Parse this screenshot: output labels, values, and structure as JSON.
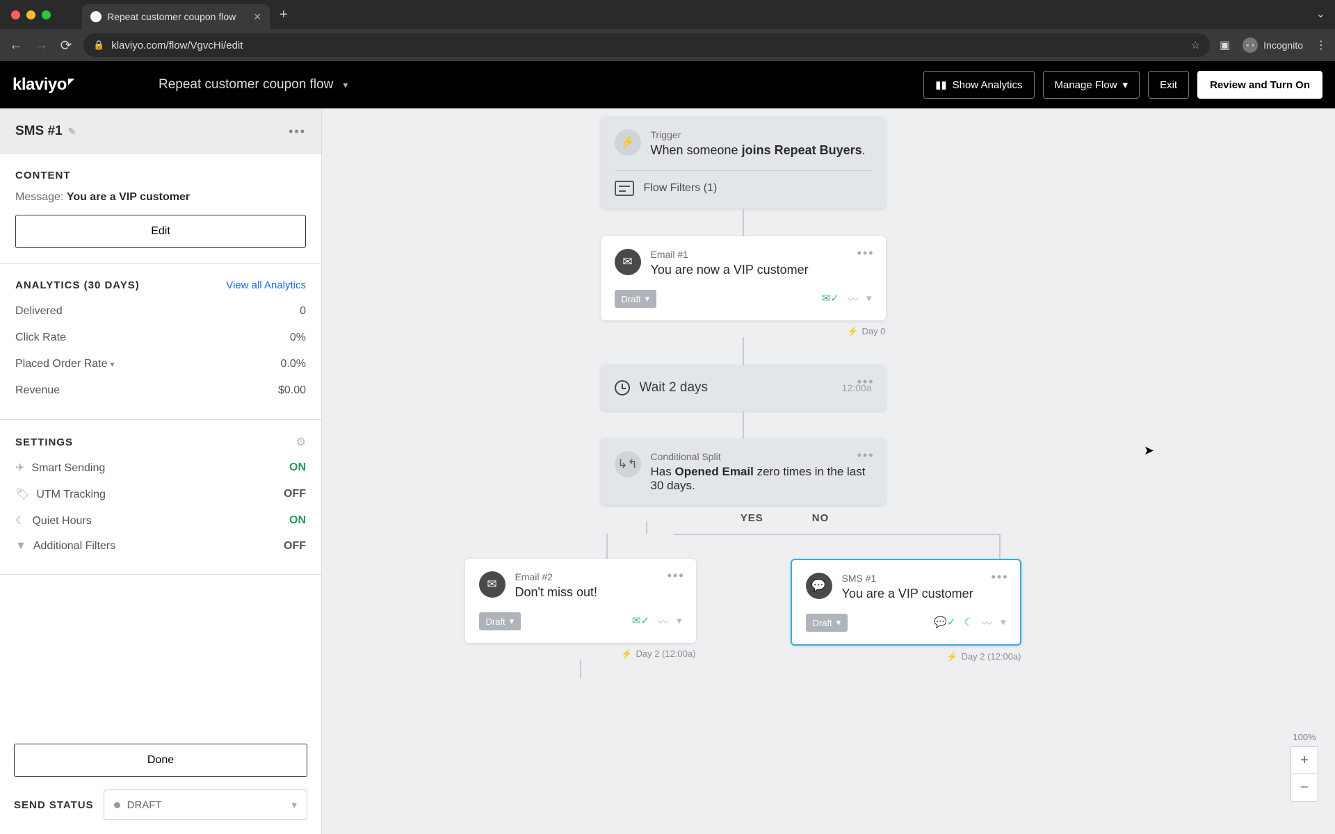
{
  "browser": {
    "tab_title": "Repeat customer coupon flow",
    "url": "klaviyo.com/flow/VgvcHi/edit",
    "incognito": "Incognito"
  },
  "topbar": {
    "logo": "klaviyo",
    "flow_name": "Repeat customer coupon flow",
    "show_analytics": "Show Analytics",
    "manage_flow": "Manage Flow",
    "exit": "Exit",
    "review": "Review and Turn On"
  },
  "sidebar": {
    "node_name": "SMS #1",
    "content": {
      "heading": "CONTENT",
      "message_label": "Message:",
      "message_value": "You are a VIP customer",
      "edit": "Edit"
    },
    "analytics": {
      "heading": "ANALYTICS (30 DAYS)",
      "view_all": "View all Analytics",
      "metrics": [
        {
          "label": "Delivered",
          "value": "0"
        },
        {
          "label": "Click Rate",
          "value": "0%"
        },
        {
          "label": "Placed Order Rate",
          "value": "0.0%"
        },
        {
          "label": "Revenue",
          "value": "$0.00"
        }
      ]
    },
    "settings": {
      "heading": "SETTINGS",
      "items": [
        {
          "label": "Smart Sending",
          "value": "ON"
        },
        {
          "label": "UTM Tracking",
          "value": "OFF"
        },
        {
          "label": "Quiet Hours",
          "value": "ON"
        },
        {
          "label": "Additional Filters",
          "value": "OFF"
        }
      ]
    },
    "done": "Done",
    "send_status": {
      "label": "SEND STATUS",
      "value": "DRAFT"
    }
  },
  "flow": {
    "trigger": {
      "label": "Trigger",
      "prefix": "When someone ",
      "bold": "joins Repeat Buyers",
      "suffix": ".",
      "filters": "Flow Filters (1)"
    },
    "email1": {
      "label": "Email #1",
      "title": "You are now a VIP customer",
      "status": "Draft",
      "day": "Day 0"
    },
    "wait": {
      "title": "Wait 2 days",
      "time": "12:00a"
    },
    "split": {
      "label": "Conditional Split",
      "prefix": "Has ",
      "bold": "Opened Email",
      "suffix": " zero times in the last 30 days.",
      "yes": "YES",
      "no": "NO"
    },
    "email2": {
      "label": "Email #2",
      "title": "Don't miss out!",
      "status": "Draft",
      "day": "Day 2 (12:00a)"
    },
    "sms1": {
      "label": "SMS #1",
      "title": "You are a VIP customer",
      "status": "Draft",
      "day": "Day 2 (12:00a)"
    }
  },
  "zoom": {
    "level": "100%"
  }
}
